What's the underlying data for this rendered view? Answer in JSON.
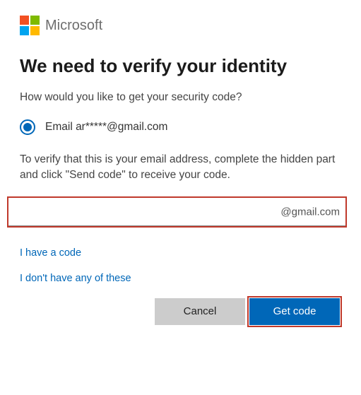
{
  "brand": "Microsoft",
  "title": "We need to verify your identity",
  "subtitle": "How would you like to get your security code?",
  "radio": {
    "label": "Email ar*****@gmail.com"
  },
  "instruction": "To verify that this is your email address, complete the hidden part and click \"Send code\" to receive your code.",
  "input": {
    "suffix": "@gmail.com",
    "value": ""
  },
  "links": {
    "have_code": "I have a code",
    "none": "I don't have any of these"
  },
  "buttons": {
    "cancel": "Cancel",
    "get_code": "Get code"
  }
}
